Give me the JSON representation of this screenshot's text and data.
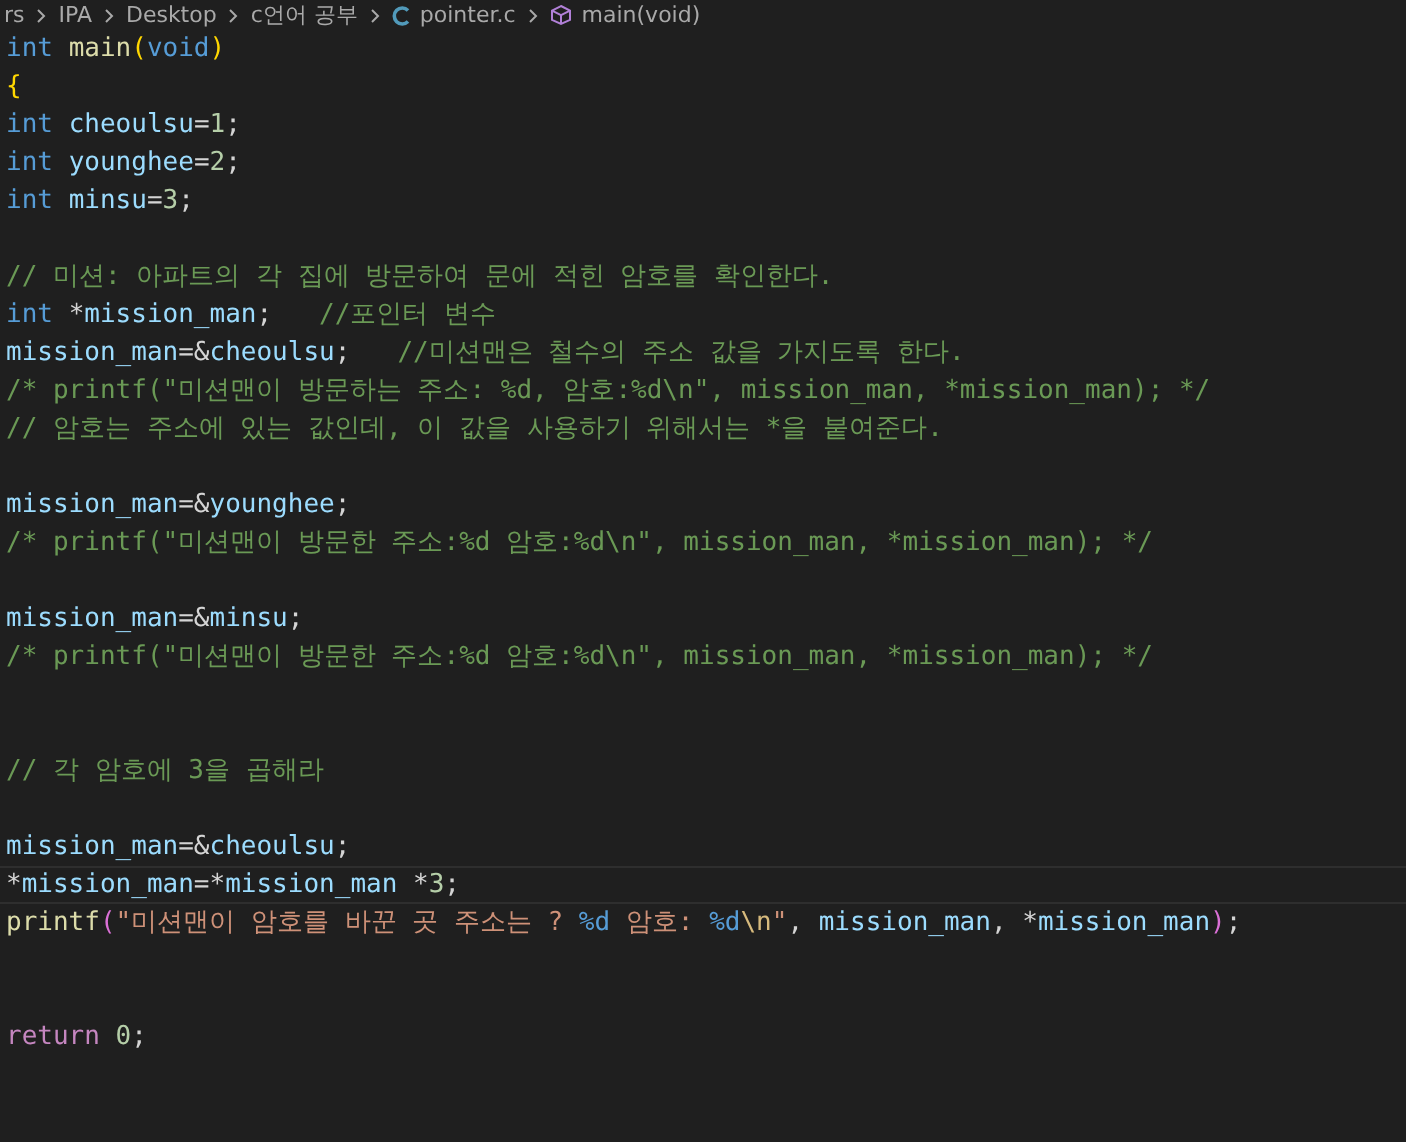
{
  "breadcrumb": [
    {
      "text": "rs",
      "kind": "folder"
    },
    {
      "text": "IPA",
      "kind": "folder"
    },
    {
      "text": "Desktop",
      "kind": "folder"
    },
    {
      "text": "c언어 공부",
      "kind": "folder"
    },
    {
      "text": "pointer.c",
      "kind": "file"
    },
    {
      "text": "main(void)",
      "kind": "symbol"
    }
  ],
  "lines": [
    {
      "current": false,
      "tokens": [
        {
          "kind": "kw",
          "text": "int "
        },
        {
          "kind": "fn",
          "text": "main"
        },
        {
          "kind": "p1",
          "text": "("
        },
        {
          "kind": "kw",
          "text": "void"
        },
        {
          "kind": "p1",
          "text": ")"
        }
      ]
    },
    {
      "current": false,
      "tokens": [
        {
          "kind": "p1",
          "text": "{"
        }
      ]
    },
    {
      "current": false,
      "tokens": [
        {
          "kind": "kw",
          "text": "int "
        },
        {
          "kind": "var",
          "text": "cheoulsu"
        },
        {
          "kind": "pl",
          "text": "="
        },
        {
          "kind": "num",
          "text": "1"
        },
        {
          "kind": "pl",
          "text": ";"
        }
      ]
    },
    {
      "current": false,
      "tokens": [
        {
          "kind": "kw",
          "text": "int "
        },
        {
          "kind": "var",
          "text": "younghee"
        },
        {
          "kind": "pl",
          "text": "="
        },
        {
          "kind": "num",
          "text": "2"
        },
        {
          "kind": "pl",
          "text": ";"
        }
      ]
    },
    {
      "current": false,
      "tokens": [
        {
          "kind": "kw",
          "text": "int "
        },
        {
          "kind": "var",
          "text": "minsu"
        },
        {
          "kind": "pl",
          "text": "="
        },
        {
          "kind": "num",
          "text": "3"
        },
        {
          "kind": "pl",
          "text": ";"
        }
      ]
    },
    {
      "current": false
    },
    {
      "current": false,
      "tokens": [
        {
          "kind": "cm",
          "text": "// 미션: 아파트의 각 집에 방문하여 문에 적힌 암호를 확인한다."
        }
      ]
    },
    {
      "current": false,
      "tokens": [
        {
          "kind": "kw",
          "text": "int "
        },
        {
          "kind": "pl",
          "text": "*"
        },
        {
          "kind": "var",
          "text": "mission_man"
        },
        {
          "kind": "pl",
          "text": ";   "
        },
        {
          "kind": "cm",
          "text": "//포인터 변수"
        }
      ]
    },
    {
      "current": false,
      "tokens": [
        {
          "kind": "var",
          "text": "mission_man"
        },
        {
          "kind": "pl",
          "text": "=&"
        },
        {
          "kind": "var",
          "text": "cheoulsu"
        },
        {
          "kind": "pl",
          "text": ";   "
        },
        {
          "kind": "cm",
          "text": "//미션맨은 철수의 주소 값을 가지도록 한다."
        }
      ]
    },
    {
      "current": false,
      "tokens": [
        {
          "kind": "cm",
          "text": "/* printf(\"미션맨이 방문하는 주소: %d, 암호:%d\\n\", mission_man, *mission_man); */"
        }
      ]
    },
    {
      "current": false,
      "tokens": [
        {
          "kind": "cm",
          "text": "// 암호는 주소에 있는 값인데, 이 값을 사용하기 위해서는 *을 붙여준다."
        }
      ]
    },
    {
      "current": false
    },
    {
      "current": false,
      "tokens": [
        {
          "kind": "var",
          "text": "mission_man"
        },
        {
          "kind": "pl",
          "text": "=&"
        },
        {
          "kind": "var",
          "text": "younghee"
        },
        {
          "kind": "pl",
          "text": ";"
        }
      ]
    },
    {
      "current": false,
      "tokens": [
        {
          "kind": "cm",
          "text": "/* printf(\"미션맨이 방문한 주소:%d 암호:%d\\n\", mission_man, *mission_man); */"
        }
      ]
    },
    {
      "current": false
    },
    {
      "current": false,
      "tokens": [
        {
          "kind": "var",
          "text": "mission_man"
        },
        {
          "kind": "pl",
          "text": "=&"
        },
        {
          "kind": "var",
          "text": "minsu"
        },
        {
          "kind": "pl",
          "text": ";"
        }
      ]
    },
    {
      "current": false,
      "tokens": [
        {
          "kind": "cm",
          "text": "/* printf(\"미션맨이 방문한 주소:%d 암호:%d\\n\", mission_man, *mission_man); */"
        }
      ]
    },
    {
      "current": false
    },
    {
      "current": false
    },
    {
      "current": false,
      "tokens": [
        {
          "kind": "cm",
          "text": "// 각 암호에 3을 곱해라"
        }
      ]
    },
    {
      "current": false
    },
    {
      "current": false,
      "tokens": [
        {
          "kind": "var",
          "text": "mission_man"
        },
        {
          "kind": "pl",
          "text": "=&"
        },
        {
          "kind": "var",
          "text": "cheoulsu"
        },
        {
          "kind": "pl",
          "text": ";"
        }
      ]
    },
    {
      "current": true,
      "tokens": [
        {
          "kind": "pl",
          "text": "*"
        },
        {
          "kind": "var",
          "text": "mission_man"
        },
        {
          "kind": "pl",
          "text": "=*"
        },
        {
          "kind": "var",
          "text": "mission_man"
        },
        {
          "kind": "pl",
          "text": " *"
        },
        {
          "kind": "num",
          "text": "3"
        },
        {
          "kind": "pl",
          "text": ";"
        }
      ]
    },
    {
      "current": false,
      "tokens": [
        {
          "kind": "fn",
          "text": "printf"
        },
        {
          "kind": "p2",
          "text": "("
        },
        {
          "kind": "str",
          "text": "\"미션맨이 암호를 바꾼 곳 주소는 ? "
        },
        {
          "kind": "fmt",
          "text": "%d"
        },
        {
          "kind": "str",
          "text": " 암호: "
        },
        {
          "kind": "fmt",
          "text": "%d"
        },
        {
          "kind": "esc",
          "text": "\\n"
        },
        {
          "kind": "str",
          "text": "\""
        },
        {
          "kind": "pl",
          "text": ", "
        },
        {
          "kind": "var",
          "text": "mission_man"
        },
        {
          "kind": "pl",
          "text": ", *"
        },
        {
          "kind": "var",
          "text": "mission_man"
        },
        {
          "kind": "p2",
          "text": ")"
        },
        {
          "kind": "pl",
          "text": ";"
        }
      ]
    },
    {
      "current": false
    },
    {
      "current": false
    },
    {
      "current": false,
      "tokens": [
        {
          "kind": "ctl",
          "text": "return "
        },
        {
          "kind": "num",
          "text": "0"
        },
        {
          "kind": "pl",
          "text": ";"
        }
      ]
    }
  ]
}
